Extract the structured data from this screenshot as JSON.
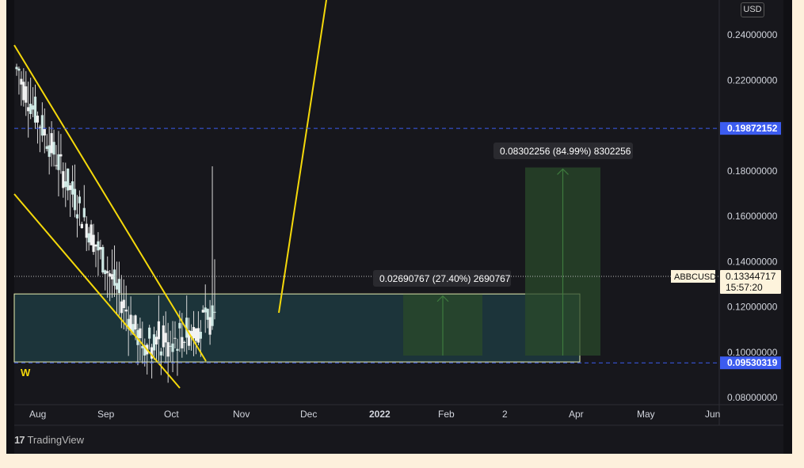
{
  "branding": {
    "footer_text": "TradingView",
    "logo_mark": "17"
  },
  "chart_data": {
    "type": "candlestick",
    "symbol": "ABBCUSD",
    "currency": "USD",
    "last_price": "0.13344717",
    "countdown": "15:57:20",
    "y_axis": {
      "range": [
        0.075,
        0.255
      ],
      "ticks": [
        "0.24000000",
        "0.22000000",
        "0.18000000",
        "0.16000000",
        "0.14000000",
        "0.12000000",
        "0.10000000",
        "0.08000000"
      ],
      "tick_values": [
        0.24,
        0.22,
        0.18,
        0.16,
        0.14,
        0.12,
        0.1,
        0.08
      ]
    },
    "x_axis": {
      "labels": [
        "Aug",
        "Sep",
        "Oct",
        "Nov",
        "Dec",
        "2022",
        "Feb",
        "2",
        "Apr",
        "May",
        "Jun"
      ],
      "label_bold": [
        false,
        false,
        false,
        false,
        false,
        true,
        false,
        false,
        false,
        false,
        false
      ]
    },
    "price_lines": [
      {
        "value": 0.19872152,
        "label": "0.19872152",
        "color": "#3c5cf0"
      },
      {
        "value": 0.09530319,
        "label": "0.09530319",
        "color": "#3c5cf0"
      }
    ],
    "measurements": [
      {
        "label": "0.02690767 (27.40%) 2690767",
        "from": 0.0985,
        "to": 0.1255
      },
      {
        "label": "0.08302256 (84.99%) 8302256",
        "from": 0.0985,
        "to": 0.1815
      }
    ],
    "zone": {
      "top": 0.1257,
      "bottom": 0.0957
    },
    "pattern_label": "W",
    "colors": {
      "bull": "#cfe9e5",
      "bear": "#f2f2f2",
      "trendline": "#f5d90a",
      "zone_fill": "#1d3a40",
      "measure_fill": "#2a4a2a"
    }
  }
}
